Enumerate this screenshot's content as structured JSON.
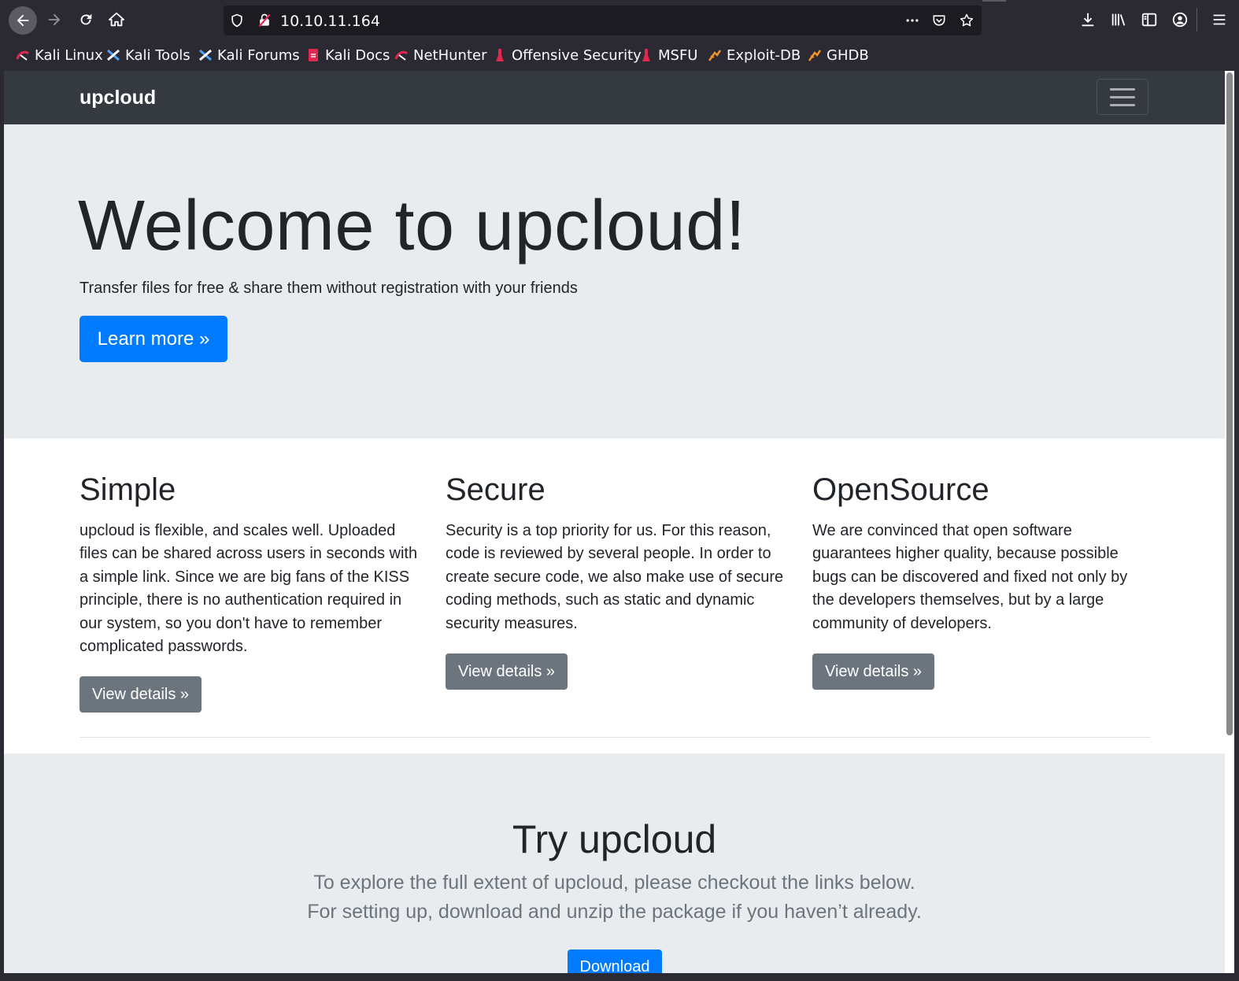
{
  "browser": {
    "url": "10.10.11.164",
    "bookmarks": [
      {
        "label": "Kali Linux",
        "icon": "kali-linux-icon"
      },
      {
        "label": "Kali Tools",
        "icon": "kali-tools-icon"
      },
      {
        "label": "Kali Forums",
        "icon": "kali-forums-icon"
      },
      {
        "label": "Kali Docs",
        "icon": "kali-docs-icon"
      },
      {
        "label": "NetHunter",
        "icon": "nethunter-icon"
      },
      {
        "label": "Offensive Security",
        "icon": "offensive-security-icon"
      },
      {
        "label": "MSFU",
        "icon": "msfu-icon"
      },
      {
        "label": "Exploit-DB",
        "icon": "exploit-db-icon"
      },
      {
        "label": "GHDB",
        "icon": "ghdb-icon"
      }
    ]
  },
  "page": {
    "navbar": {
      "brand": "upcloud"
    },
    "hero": {
      "title": "Welcome to upcloud!",
      "lead": "Transfer files for free & share them without registration with your friends",
      "cta": "Learn more »"
    },
    "features": [
      {
        "title": "Simple",
        "body": "upcloud is flexible, and scales well. Uploaded files can be shared across users in seconds with a simple link. Since we are big fans of the KISS principle, there is no authentication required in our system, so you don't have to remember complicated passwords.",
        "button": "View details »"
      },
      {
        "title": "Secure",
        "body": "Security is a top priority for us. For this reason, code is reviewed by several people. In order to create secure code, we also make use of secure coding methods, such as static and dynamic security measures.",
        "button": "View details »"
      },
      {
        "title": "OpenSource",
        "body": "We are convinced that open software guarantees higher quality, because possible bugs can be discovered and fixed not only by the developers themselves, but by a large community of developers.",
        "button": "View details »"
      }
    ],
    "try": {
      "title": "Try upcloud",
      "line1": "To explore the full extent of upcloud, please checkout the links below.",
      "line2": "For setting up, download and unzip the package if you haven’t already.",
      "download": "Download"
    }
  },
  "colors": {
    "navbar": "#343a40",
    "jumbotron": "#e9ecef",
    "primary": "#007bff",
    "secondary": "#6c757d",
    "browser_chrome": "#2b2a33"
  }
}
